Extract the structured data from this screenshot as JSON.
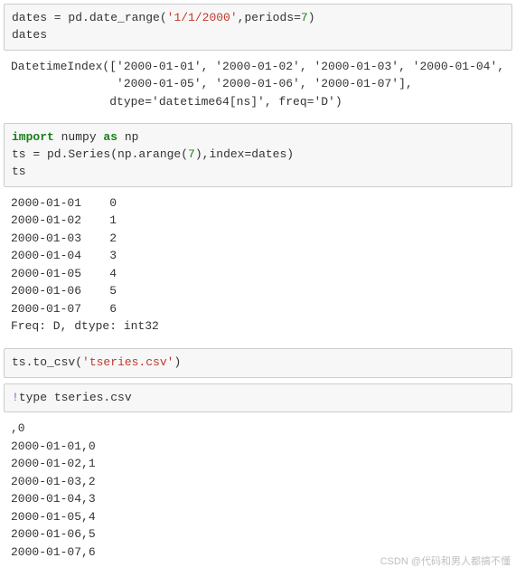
{
  "cell1": {
    "t1": "dates = pd.date_range(",
    "s1": "'1/1/2000'",
    "t2": ",periods=",
    "n1": "7",
    "t3": ")",
    "line2": "dates"
  },
  "out1": "DatetimeIndex(['2000-01-01', '2000-01-02', '2000-01-03', '2000-01-04',\n               '2000-01-05', '2000-01-06', '2000-01-07'],\n              dtype='datetime64[ns]', freq='D')",
  "cell2": {
    "kw1": "import",
    "t1": " numpy ",
    "kw2": "as",
    "t2": " np",
    "t3": "ts = pd.Series(np.arange(",
    "n1": "7",
    "t4": "),index=dates)",
    "line3": "ts"
  },
  "out2": "2000-01-01    0\n2000-01-02    1\n2000-01-03    2\n2000-01-04    3\n2000-01-05    4\n2000-01-06    5\n2000-01-07    6\nFreq: D, dtype: int32",
  "cell3": {
    "t1": "ts.to_csv(",
    "s1": "'tseries.csv'",
    "t2": ")"
  },
  "cell4": {
    "bang": "!",
    "t1": "type tseries.csv"
  },
  "out4": ",0\n2000-01-01,0\n2000-01-02,1\n2000-01-03,2\n2000-01-04,3\n2000-01-05,4\n2000-01-06,5\n2000-01-07,6",
  "watermark": "CSDN @代码和男人都搞不懂"
}
